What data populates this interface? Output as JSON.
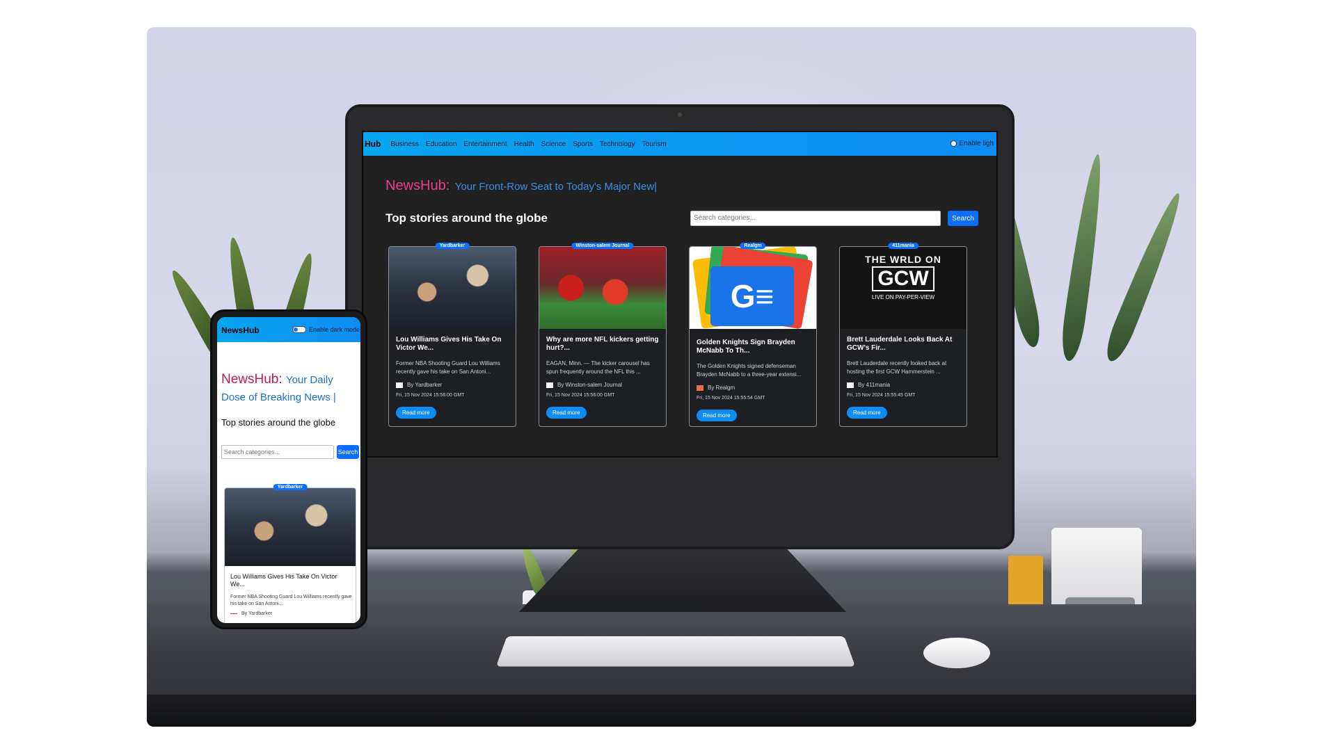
{
  "desktop": {
    "nav": {
      "brand": "Hub",
      "links": [
        "Business",
        "Education",
        "Entertainment",
        "Health",
        "Science",
        "Sports",
        "Technology",
        "Tourism"
      ],
      "toggle_label": "Enable ligh"
    },
    "hero": {
      "brand": "NewsHub:",
      "tagline": "Your Front-Row Seat to Today's Major New|"
    },
    "section_title": "Top stories around the globe",
    "search": {
      "placeholder": "Search categories...",
      "button": "Search"
    },
    "cards": [
      {
        "source": "Yardbarker",
        "title": "Lou Williams Gives His Take On Victor We...",
        "desc": "Former NBA Shooting Guard Lou Williams recently gave his take on San Antoni...",
        "by": "By Yardbarker",
        "date": "Fri, 15 Nov 2024 15:56:00 GMT",
        "button": "Read more"
      },
      {
        "source": "Winston-salem Journal",
        "title": "Why are more NFL kickers getting hurt?...",
        "desc": "EAGAN, Minn. — The kicker carousel has spun frequently around the NFL this ...",
        "by": "By Winston-salem Journal",
        "date": "Fri, 15 Nov 2024 15:56:00 GMT",
        "button": "Read more"
      },
      {
        "source": "Realgm",
        "title": "Golden Knights Sign Brayden McNabb To Th...",
        "desc": "The Golden Knights signed defenseman Brayden McNabb to a three-year extensi...",
        "by": "By Realgm",
        "date": "Fri, 15 Nov 2024 15:55:54 GMT",
        "button": "Read more"
      },
      {
        "source": "411mania",
        "title": "Brett Lauderdale Looks Back At GCW's Fir...",
        "desc": "Brett Lauderdale recently looked back at hosting the first GCW Hammerstein ...",
        "by": "By 411mania",
        "date": "Fri, 15 Nov 2024 15:55:45 GMT",
        "button": "Read more"
      }
    ],
    "gcw_art": {
      "top": "THE WRLD ON",
      "logo": "GCW",
      "sub": "LIVE ON PAY-PER-VIEW"
    }
  },
  "mobile": {
    "nav": {
      "brand": "NewsHub",
      "toggle_label": "Enable dark mode"
    },
    "hero": {
      "brand": "NewsHub:",
      "tagline": "Your Daily Dose of Breaking News |"
    },
    "section_title": "Top stories around the globe",
    "search": {
      "placeholder": "Search categories...",
      "button": "Search"
    },
    "card": {
      "source": "Yardbarker",
      "title": "Lou Williams Gives His Take On Victor We...",
      "desc": "Former NBA Shooting Guard Lou Williams recently gave his take on San Antoni...",
      "by": "By Yardbarker"
    }
  },
  "colors": {
    "nav_gradient": [
      "#0aa5ef",
      "#0d8cf3"
    ],
    "brand_pink": "#e83e8c",
    "accent_blue": "#0d6efd",
    "dark_bg": "#212121"
  }
}
